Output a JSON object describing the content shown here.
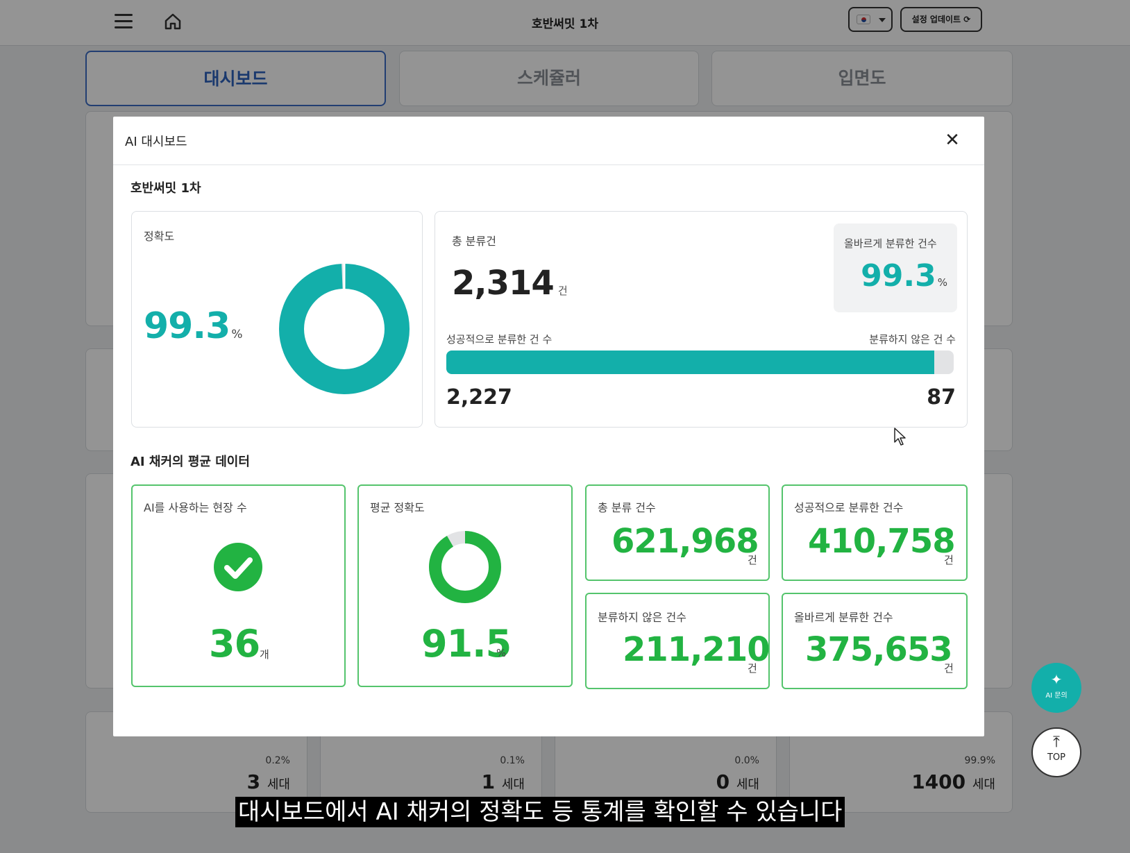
{
  "header": {
    "title": "호반써밋 1차",
    "update_button": "설정 업데이트 ⟳",
    "language": "KR"
  },
  "tabs": [
    {
      "label": "대시보드",
      "active": true
    },
    {
      "label": "스케쥴러",
      "active": false
    },
    {
      "label": "입면도",
      "active": false
    }
  ],
  "background_stats": [
    {
      "percent": "0.2%",
      "value": "3",
      "unit": "세대"
    },
    {
      "percent": "0.1%",
      "value": "1",
      "unit": "세대"
    },
    {
      "percent": "0.0%",
      "value": "0",
      "unit": "세대"
    },
    {
      "percent": "99.9%",
      "value": "1400",
      "unit": "세대"
    }
  ],
  "modal": {
    "title": "AI 대시보드",
    "site_name": "호반써밋 1차",
    "accuracy": {
      "label": "정확도",
      "value": "99.3",
      "unit": "%",
      "fraction": 0.993
    },
    "classification": {
      "total_label": "총 분류건",
      "total_value": "2,314",
      "total_unit": "건",
      "correct_label": "올바르게 분류한 건수",
      "correct_value": "99.3",
      "correct_unit": "%",
      "success_label": "성공적으로 분류한 건 수",
      "unclassified_label": "분류하지 않은 건 수",
      "success_value": "2,227",
      "unclassified_value": "87",
      "success_fraction": 0.962
    },
    "averages": {
      "section_title": "AI 채커의 평균 데이터",
      "sites": {
        "label": "AI를 사용하는 현장 수",
        "value": "36",
        "unit": "개"
      },
      "avg_accuracy": {
        "label": "평균 정확도",
        "value": "91.5",
        "unit": "%",
        "fraction": 0.915
      },
      "total": {
        "label": "총 분류 건수",
        "value": "621,968",
        "unit": "건"
      },
      "success": {
        "label": "성공적으로 분류한 건수",
        "value": "410,758",
        "unit": "건"
      },
      "unclassified": {
        "label": "분류하지 않은 건수",
        "value": "211,210",
        "unit": "건"
      },
      "correct": {
        "label": "올바르게 분류한 건수",
        "value": "375,653",
        "unit": "건"
      }
    }
  },
  "floating": {
    "ai_label": "AI 문의",
    "top_label": "TOP"
  },
  "subtitle": "대시보드에서 AI 채커의 정확도 등 통계를 확인할 수 있습니다",
  "colors": {
    "teal": "#13afaa",
    "green": "#22b342",
    "tab_active": "#2e62be",
    "track": "#e2e3e5"
  }
}
